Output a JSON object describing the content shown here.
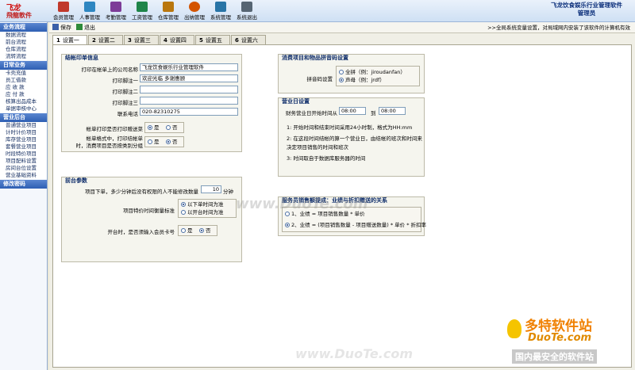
{
  "logo": {
    "big": "飞龙",
    "small": "飛龍軟件"
  },
  "toolbar": [
    {
      "label": "会员管理",
      "icon": "member-icon",
      "color": "#c0392b"
    },
    {
      "label": "人事管理",
      "icon": "personnel-icon",
      "color": "#2e86c1"
    },
    {
      "label": "考勤管理",
      "icon": "attendance-icon",
      "color": "#7d3c98"
    },
    {
      "label": "工资管理",
      "icon": "salary-icon",
      "color": "#1e8449"
    },
    {
      "label": "仓库管理",
      "icon": "warehouse-icon",
      "color": "#b9770e"
    },
    {
      "label": "出纳管理",
      "icon": "cashier-icon",
      "color": "#d35400"
    },
    {
      "label": "系统管理",
      "icon": "system-icon",
      "color": "#2874a6"
    },
    {
      "label": "系统退出",
      "icon": "exit-icon",
      "color": "#566573"
    }
  ],
  "app_title": {
    "line1": "飞龙饮食娱乐行业管理软件",
    "line2": "管理员"
  },
  "sidebar": {
    "sections": [
      {
        "title": "业务流程",
        "items": [
          "数据流程",
          "前台流程",
          "仓库流程",
          "流转流程"
        ]
      },
      {
        "title": "日常业务",
        "items": [
          "卡壳充值",
          "员工借款",
          "应 收 款",
          "应 付 款",
          "核算出品成本",
          "单据审核中心"
        ]
      },
      {
        "title": "营业后台",
        "items": [
          "普通营业项目",
          "计时计价项目",
          "库存营业项目",
          "套餐营业项目",
          "时段特价项目",
          "项目配料设置",
          "房间台位设置",
          "营业基础资料"
        ]
      },
      {
        "title": "修改密码",
        "items": []
      }
    ]
  },
  "action_bar": {
    "save": "保存",
    "exit": "退出",
    "notice": ">>全局系统变量设置，对局域网内安装了该软件的计算机有效"
  },
  "tabs": [
    {
      "num": "1",
      "label": "设置一"
    },
    {
      "num": "2",
      "label": "设置二"
    },
    {
      "num": "3",
      "label": "设置三"
    },
    {
      "num": "4",
      "label": "设置四"
    },
    {
      "num": "5",
      "label": "设置五"
    },
    {
      "num": "6",
      "label": "设置六"
    }
  ],
  "bill_print": {
    "title": "结帐印单信息",
    "company_label": "打印在帐单上的公司名称",
    "company_value": "飞龙饮食娱乐行业管理软件",
    "footer1_label": "打印脚注一",
    "footer1_value": "欢迎光临 多谢惠顾",
    "footer2_label": "打印脚注二",
    "footer2_value": "",
    "footer3_label": "打印脚注三",
    "footer3_value": "",
    "phone_label": "联系电话",
    "phone_value": "020-82310275",
    "print_gift_label": "帐单打印是否打印赠送菜",
    "print_gift_yes": "是",
    "print_gift_no": "否",
    "group_label_1": "帐单格式中，打印结帐单",
    "group_label_2": "时，消费项目是否按类别分组",
    "group_yes": "是",
    "group_no": "否"
  },
  "front_params": {
    "title": "前台参数",
    "cancel_label": "项目下单，多少分钟后没有权限的人不能修改数量",
    "cancel_value": "10",
    "cancel_unit": "分钟",
    "special_label": "项目特价时间衡量标准",
    "special_opt1": "以下单时间为准",
    "special_opt2": "以开台时间为准",
    "card_label": "开台时，是否须输入会员卡号",
    "card_yes": "是",
    "card_no": "否"
  },
  "pinyin": {
    "title": "消费项目和物品拼音码设置",
    "label": "拼音码设置",
    "opt1": "全拼（例：jiroudanfan）",
    "opt2": "声母（例：jrdf）"
  },
  "business_day": {
    "title": "营业日设置",
    "label": "财务营业日开始时间从",
    "from": "08:00",
    "to_label": "到",
    "to": "08:00",
    "notes": [
      "1:   开始时间和结束时间采用24小时制，格式为HH:mm",
      "2:   在这段时间结帐的算一个营业日，由结帐的班次和时间来",
      "      决定项目销售的时间和班次",
      "3:   时间取自于数据库服务器的时间"
    ]
  },
  "commission": {
    "title": "服务员销售额提成：业绩与折扣赠送的关系",
    "opt1": "1、业绩 = 项目销售数量 * 单价",
    "opt2": "2、业绩 = (项目销售数量 - 项目赠送数量) * 单价 * 折扣率"
  },
  "watermarks": {
    "center": "www.DuoTe.com",
    "corner_brand": "多特软件站",
    "corner_url": "DuoTe.com",
    "corner_slogan": "国内最安全的软件站"
  }
}
